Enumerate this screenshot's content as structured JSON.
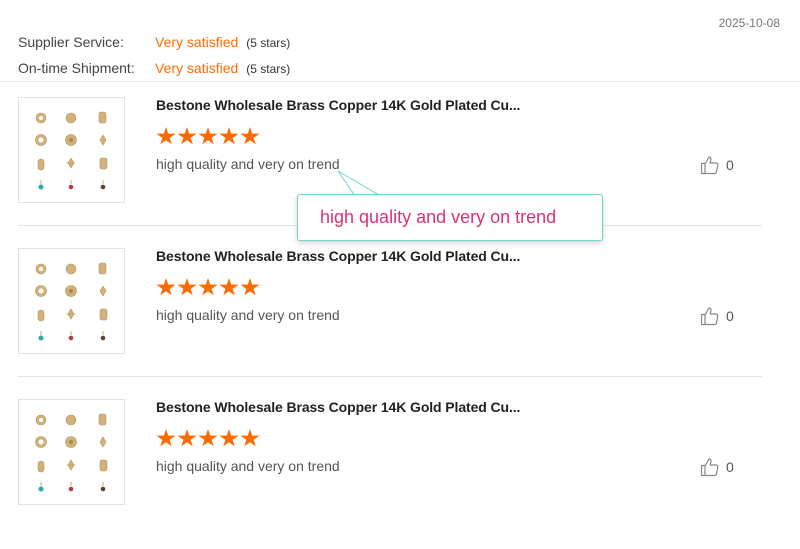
{
  "header": {
    "date": "2025-10-08",
    "ratings": [
      {
        "label": "Supplier Service:",
        "value": "Very satisfied",
        "note": "(5 stars)"
      },
      {
        "label": "On-time Shipment:",
        "value": "Very satisfied",
        "note": "(5 stars)"
      }
    ]
  },
  "reviews": [
    {
      "title": "Bestone Wholesale Brass Copper 14K Gold Plated Cu...",
      "stars": 5,
      "comment": "high quality and very on trend",
      "likes": "0"
    },
    {
      "title": "Bestone Wholesale Brass Copper 14K Gold Plated Cu...",
      "stars": 5,
      "comment": "high quality and very on trend",
      "likes": "0"
    },
    {
      "title": "Bestone Wholesale Brass Copper 14K Gold Plated Cu...",
      "stars": 5,
      "comment": "high quality and very on trend",
      "likes": "0"
    }
  ],
  "tooltip": {
    "text": "high quality and very on trend"
  },
  "colors": {
    "accent": "#ff6a00",
    "tooltip_text": "#d6337a",
    "tooltip_border": "#72d6cf"
  },
  "icons": {
    "like": "thumbs-up-icon",
    "product": "jewelry-charms-thumbnail"
  }
}
